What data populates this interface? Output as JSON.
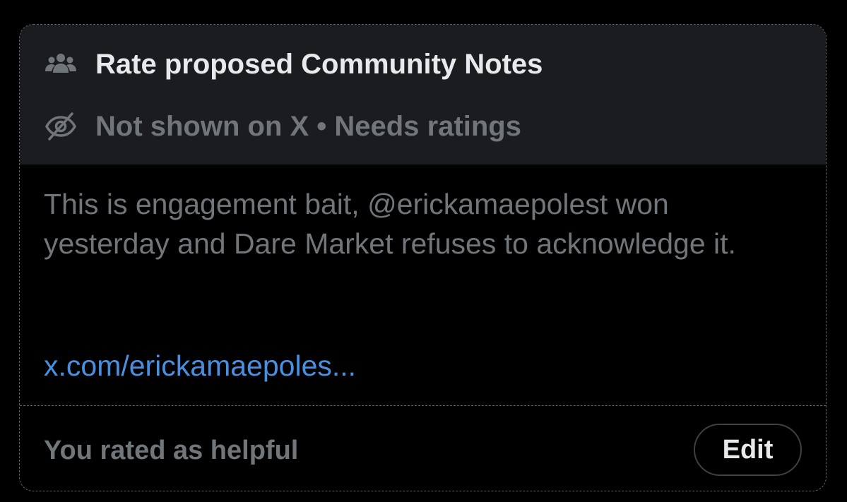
{
  "card": {
    "title": "Rate proposed Community Notes",
    "title_icon": "people-icon",
    "status": "Not shown on X • Needs ratings",
    "status_icon": "eye-off-icon"
  },
  "note": {
    "body": "This is engagement bait, @erickamaepolest won yesterday and Dare Market refuses to acknowledge it.",
    "link_text": "x.com/erickamaepoles..."
  },
  "footer": {
    "rated_text": "You rated as helpful",
    "edit_label": "Edit"
  },
  "colors": {
    "background": "#000000",
    "header_background": "#1b1c1f",
    "primary_text": "#e7e9ea",
    "secondary_text": "#71767b",
    "link": "#4a90e2"
  }
}
